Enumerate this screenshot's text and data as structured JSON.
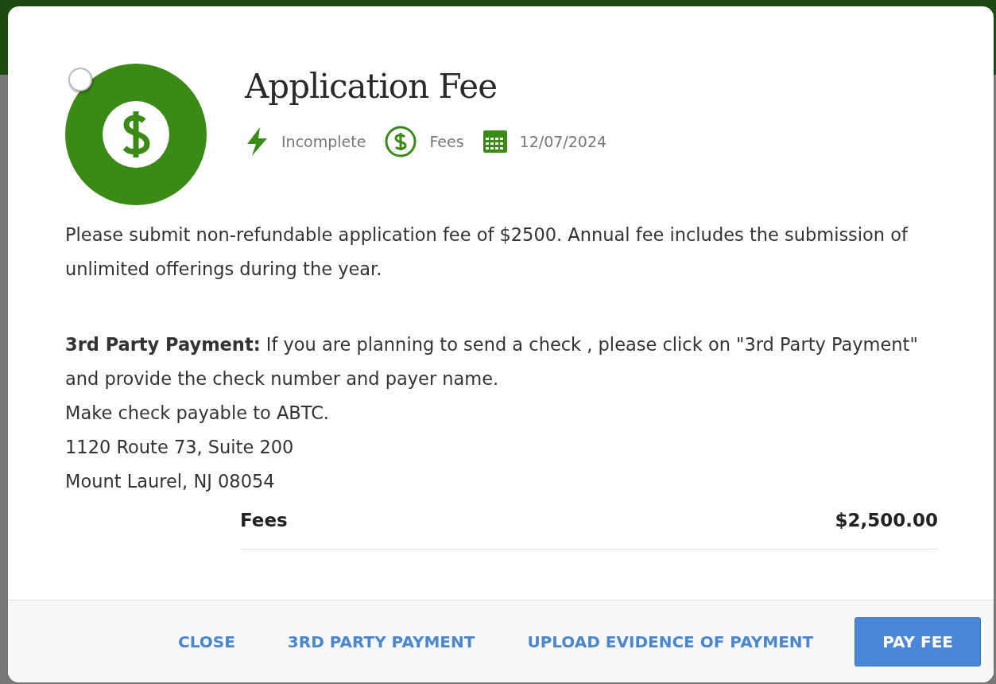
{
  "task": {
    "title": "Application Fee",
    "checked": false,
    "meta": [
      {
        "kind": "status",
        "label": "Incomplete"
      },
      {
        "kind": "category",
        "label": "Fees"
      },
      {
        "kind": "date",
        "label": "12/07/2024"
      }
    ]
  },
  "description": [
    "Please submit non-refundable application fee of $2500. Annual fee includes the submission of unlimited offerings during the year."
  ],
  "instructions": [
    "**3rd Party Payment:** If you are planning to send a check , please click on \"3rd Party Payment\" and provide the check number and payer name.",
    "Make check payable to ABTC.",
    "1120 Route 73, Suite 200",
    "Mount Laurel, NJ 08054"
  ],
  "fees": [
    {
      "label": "Fees",
      "amount": "$2,500.00"
    }
  ],
  "buttons": [
    {
      "kind": "link",
      "label": "CLOSE"
    },
    {
      "kind": "link",
      "label": "3RD PARTY PAYMENT"
    },
    {
      "kind": "link",
      "label": "UPLOAD EVIDENCE OF PAYMENT"
    },
    {
      "kind": "primary",
      "label": "PAY FEE"
    }
  ]
}
